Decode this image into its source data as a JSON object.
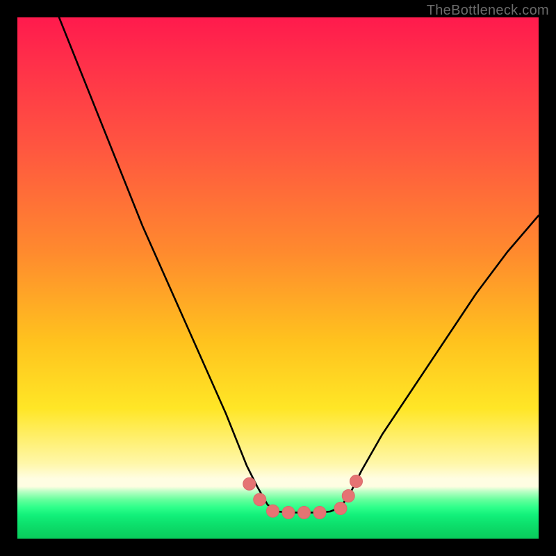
{
  "watermark": {
    "text": "TheBottleneck.com"
  },
  "colors": {
    "background": "#000000",
    "curve_stroke": "#000000",
    "marker_fill": "#e57373",
    "marker_stroke": "#d86a6a",
    "gradient_top": "#ff1a4d",
    "gradient_mid": "#ffe626",
    "gradient_bottom": "#09cc5c"
  },
  "chart_data": {
    "type": "line",
    "title": "",
    "xlabel": "",
    "ylabel": "",
    "xlim": [
      0,
      100
    ],
    "ylim": [
      0,
      100
    ],
    "notes": "V-shaped bottleneck curve. Y encodes bottleneck percentage (0 at bottom, ~100 at top). Flat-bottom optimum near x≈48–62.",
    "series": [
      {
        "name": "bottleneck-curve",
        "x": [
          8,
          12,
          16,
          20,
          24,
          28,
          32,
          36,
          40,
          42,
          44,
          46,
          48,
          50,
          52,
          54,
          56,
          58,
          60,
          62,
          64,
          66,
          70,
          76,
          82,
          88,
          94,
          100
        ],
        "y": [
          100,
          90,
          80,
          70,
          60,
          51,
          42,
          33,
          24,
          19,
          14,
          10,
          6.5,
          5.2,
          5.0,
          5.0,
          5.0,
          5.0,
          5.2,
          6.0,
          9,
          13,
          20,
          29,
          38,
          47,
          55,
          62
        ]
      }
    ],
    "markers": {
      "name": "optimum-markers",
      "x": [
        44.5,
        46.5,
        49,
        52,
        55,
        58,
        62,
        63.5,
        65
      ],
      "y": [
        10.5,
        7.5,
        5.3,
        5.0,
        5.0,
        5.0,
        5.8,
        8.2,
        11
      ]
    },
    "marker_radius": 9,
    "grid": false,
    "legend": false
  }
}
